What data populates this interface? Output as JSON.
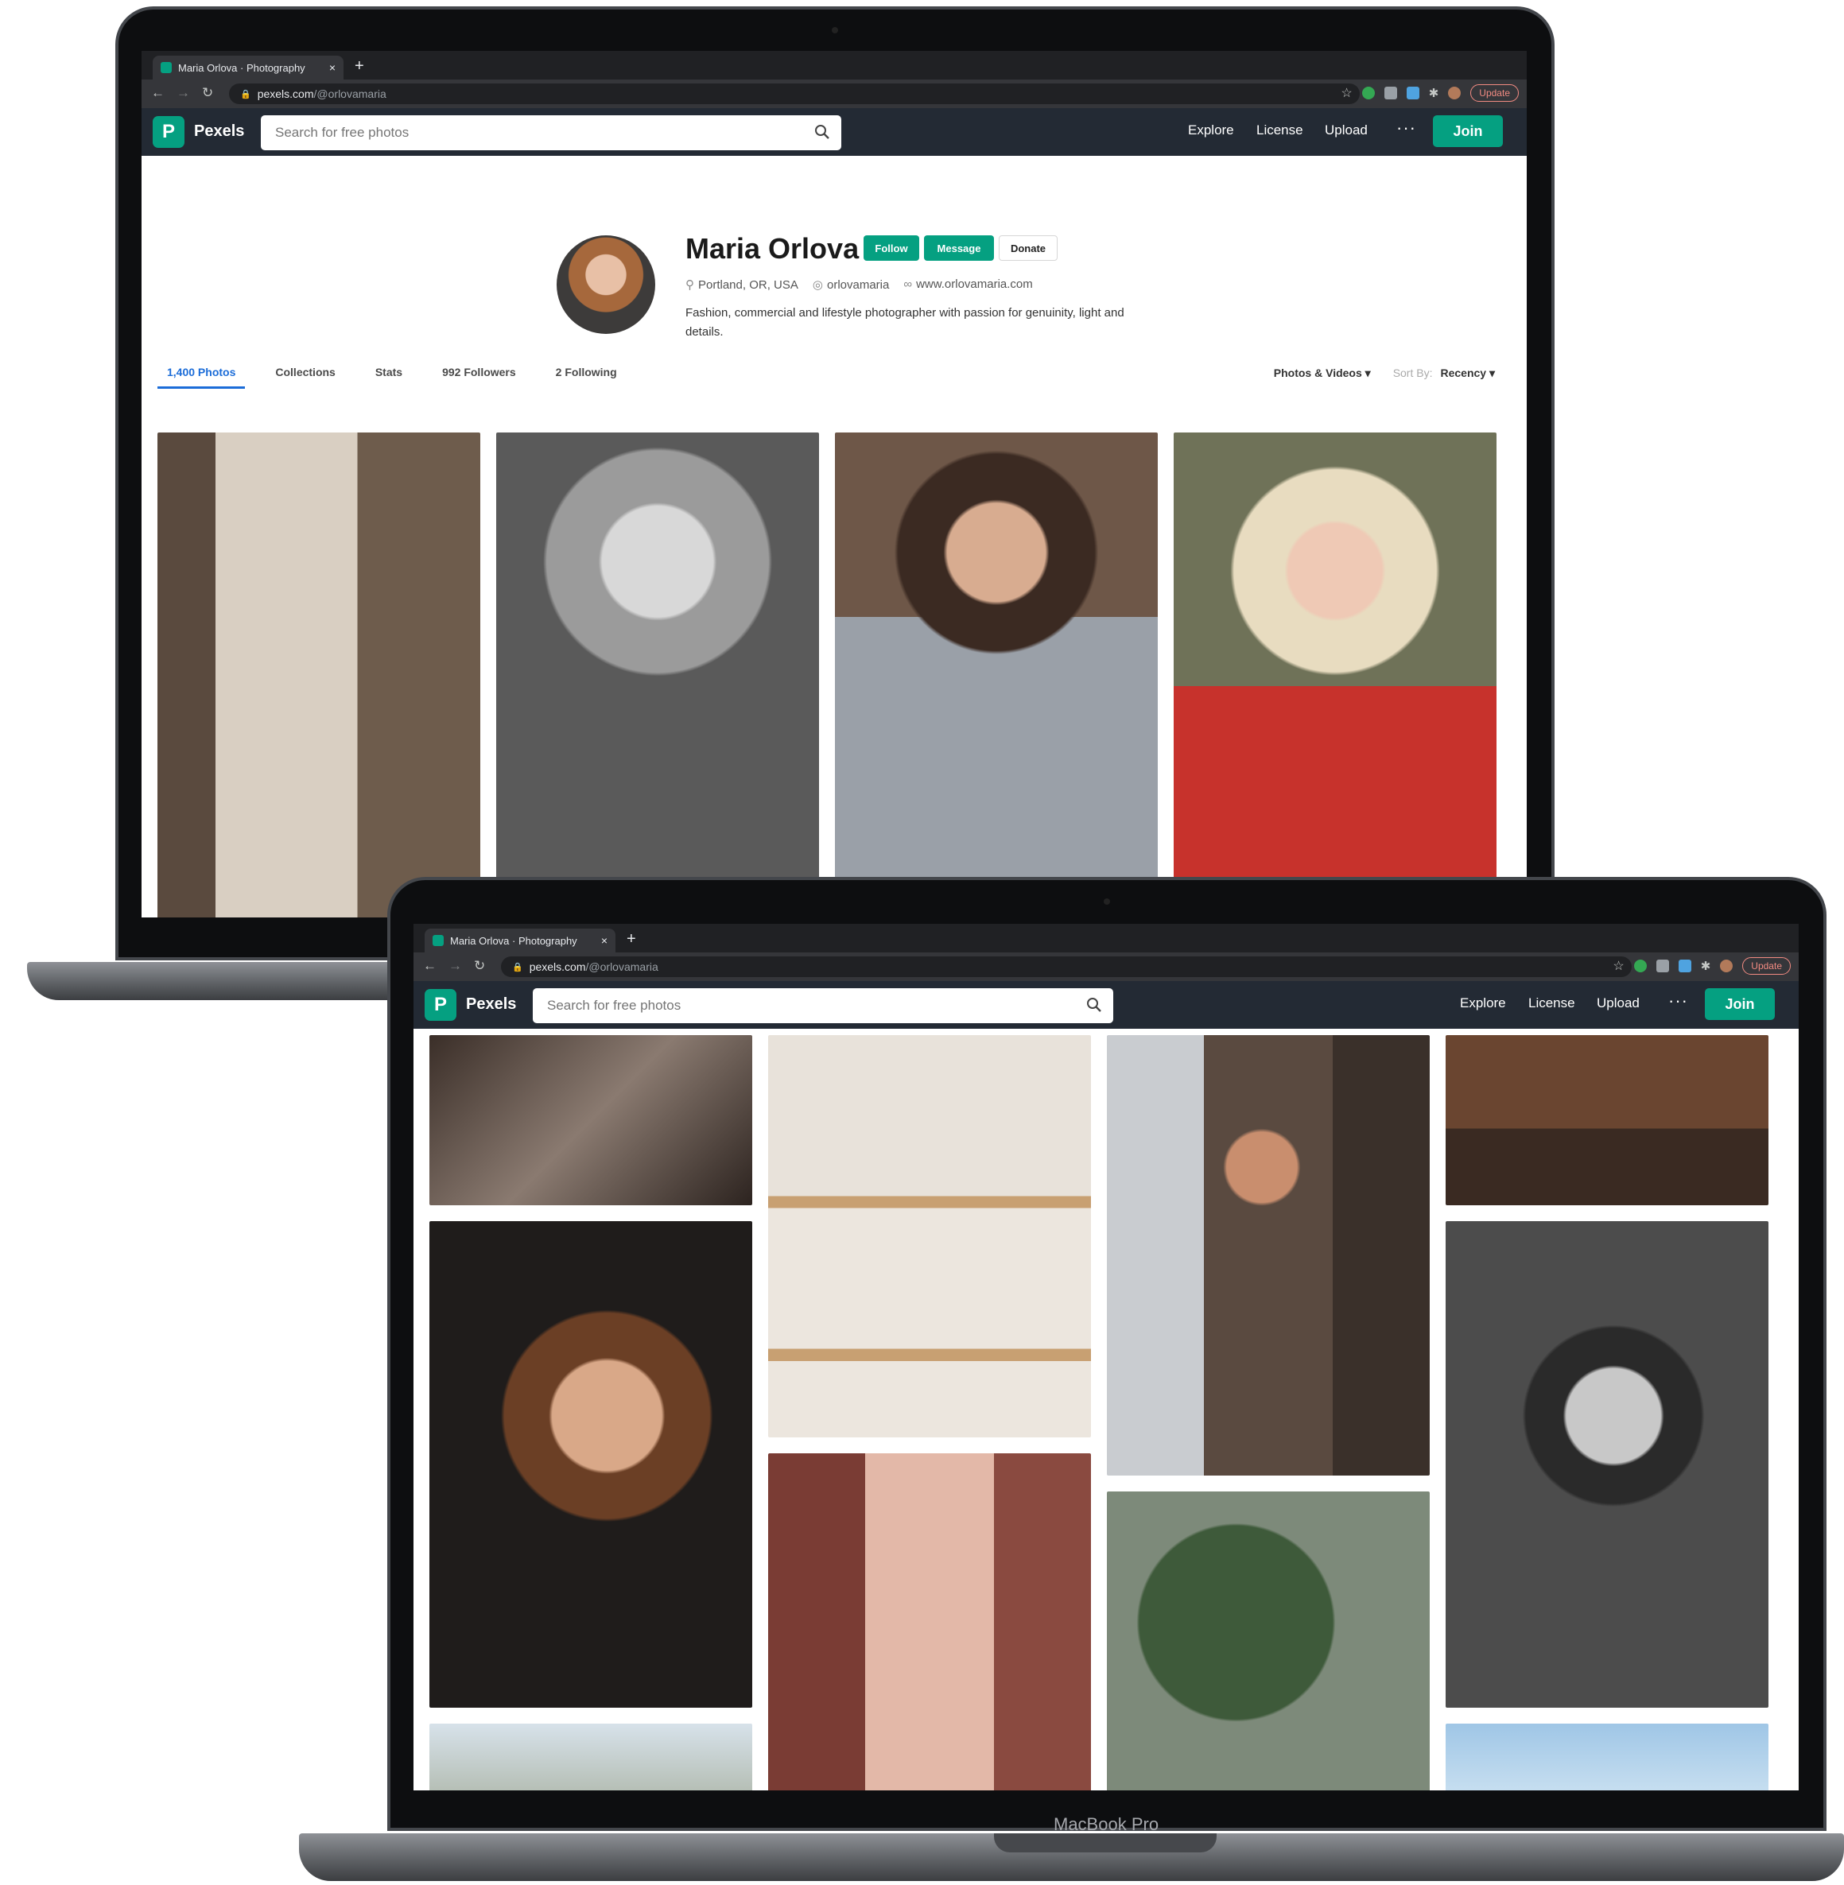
{
  "browser": {
    "tab_title": "Maria Orlova · Photography",
    "tab_close": "×",
    "new_tab": "+",
    "url_host": "pexels.com",
    "url_path": "/@orlovamaria",
    "update_label": "Update",
    "back_icon": "←",
    "forward_icon": "→",
    "reload_icon": "↻"
  },
  "nav": {
    "logo_letter": "P",
    "brand": "Pexels",
    "search_placeholder": "Search for free photos",
    "explore": "Explore",
    "license": "License",
    "upload": "Upload",
    "more": "···",
    "join": "Join"
  },
  "profile": {
    "name": "Maria Orlova",
    "follow": "Follow",
    "message": "Message",
    "donate": "Donate",
    "location": "Portland, OR, USA",
    "instagram": "orlovamaria",
    "website": "www.orlovamaria.com",
    "bio": "Fashion, commercial and lifestyle photographer with passion for genuinity, light and details."
  },
  "tabs": {
    "photos": "1,400 Photos",
    "collections": "Collections",
    "stats": "Stats",
    "followers": "992 Followers",
    "following": "2 Following"
  },
  "sort": {
    "filter": "Photos & Videos",
    "sort_by_label": "Sort By:",
    "sort_value": "Recency"
  },
  "device": {
    "label": "MacBook Pro"
  },
  "colors": {
    "pexels_green": "#05a081",
    "nav_bg": "#232a34",
    "active_tab": "#1b6cd8"
  }
}
